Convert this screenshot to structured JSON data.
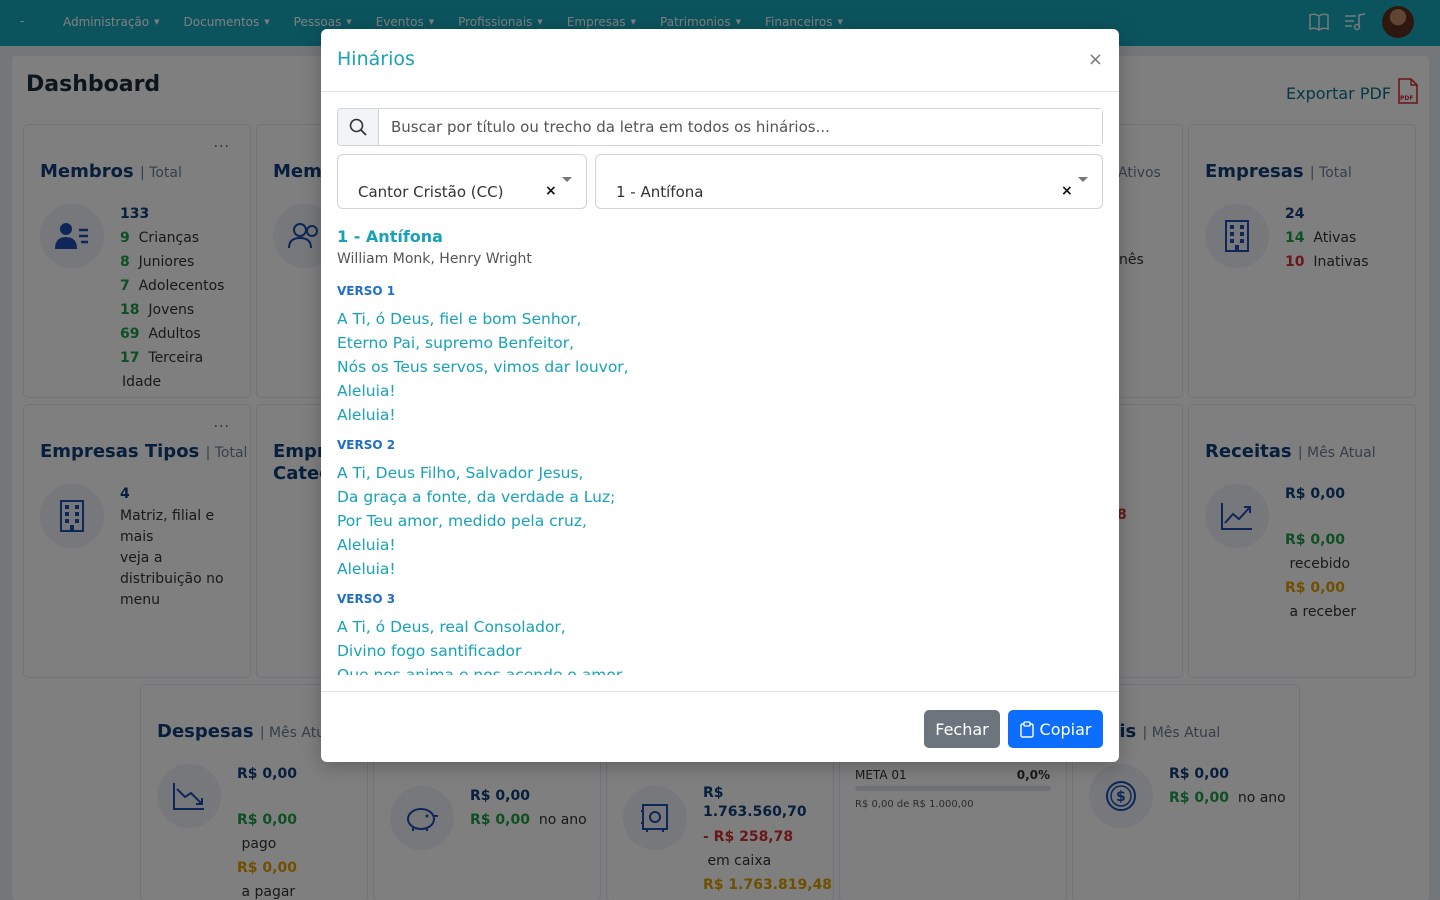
{
  "nav": {
    "brand": "-",
    "items": [
      "Administração",
      "Documentos",
      "Pessoas",
      "Eventos",
      "Profissionais",
      "Empresas",
      "Patrimonios",
      "Financeiros"
    ],
    "caret": "▼"
  },
  "dashboard": {
    "title": "Dashboard",
    "export_label": "Exportar PDF",
    "dots": "...",
    "cards": {
      "membros": {
        "title": "Membros",
        "sub": "| Total",
        "total": "133",
        "rows": [
          [
            "9",
            "Crianças"
          ],
          [
            "8",
            "Juniores"
          ],
          [
            "7",
            "Adolecentos"
          ],
          [
            "18",
            "Jovens"
          ],
          [
            "69",
            "Adultos"
          ],
          [
            "17",
            "Terceira"
          ]
        ],
        "tail": "Idade"
      },
      "membros2": {
        "title": "Memb"
      },
      "empresas": {
        "title": "Empresas",
        "sub": "| Total",
        "total": "24",
        "ativas_n": "14",
        "ativas": "Ativas",
        "inativas_n": "10",
        "inativas": "Inativas"
      },
      "ativos_fragment": "Ativos",
      "mes_fragment": "nês",
      "red_fragment": "8",
      "tipos": {
        "title": "Empresas Tipos",
        "sub": "| Total",
        "total": "4",
        "desc": [
          "Matriz, filial e",
          "mais",
          "veja a",
          "distribuição no",
          "menu"
        ]
      },
      "categ": {
        "line1": "Empr",
        "line2": "Categ"
      },
      "receitas": {
        "title": "Receitas",
        "sub": "| Mês Atual",
        "value": "R$ 0,00",
        "recebido_v": "R$ 0,00",
        "recebido": "recebido",
        "receber_v": "R$ 0,00",
        "receber": "a receber"
      },
      "despesas": {
        "title": "Despesas",
        "sub": "| Mês Atual",
        "value": "R$ 0,00",
        "pago_v": "R$ 0,00",
        "pago": "pago",
        "pagar_v": "R$ 0,00",
        "pagar": "a pagar"
      },
      "piggy": {
        "value": "R$ 0,00",
        "ano_v": "R$ 0,00",
        "ano": "no ano"
      },
      "caixa": {
        "value_l1": "R$",
        "value_l2": "1.763.560,70",
        "neg": "- R$ 258,78",
        "caixa": "em caixa",
        "total": "R$ 1.763.819,48"
      },
      "meta": {
        "name": "META 01",
        "pct": "0,0%",
        "progress": 0.0,
        "desc": "R$ 0,00 de R$ 1.000,00"
      },
      "atuais": {
        "title": "ntuais",
        "sub": "| Mês Atual",
        "value": "R$ 0,00",
        "ano_v": "R$ 0,00",
        "ano": "no ano"
      }
    }
  },
  "modal": {
    "title": "Hinários",
    "close_symbol": "×",
    "search_placeholder": "Buscar por título ou trecho da letra em todos os hinários...",
    "hymnal_select": "Cantor Cristão (CC)",
    "hymn_select": "1 - Antífona",
    "clear_symbol": "×",
    "hymn": {
      "title": "1 - Antífona",
      "author": "William Monk, Henry Wright",
      "verses": [
        {
          "label": "VERSO 1",
          "lines": [
            "A Ti, ó Deus, fiel e bom Senhor,",
            "Eterno Pai, supremo Benfeitor,",
            "Nós os Teus servos, vimos dar louvor,",
            "Aleluia!",
            "Aleluia!"
          ]
        },
        {
          "label": "VERSO 2",
          "lines": [
            "A Ti, Deus Filho, Salvador Jesus,",
            "Da graça a fonte, da verdade a Luz;",
            "Por Teu amor, medido pela cruz,",
            "Aleluia!",
            "Aleluia!"
          ]
        },
        {
          "label": "VERSO 3",
          "lines": [
            "A Ti, ó Deus, real Consolador,",
            "Divino fogo santificador",
            "Que nos anima e nos acende o amor,"
          ]
        }
      ]
    },
    "buttons": {
      "close": "Fechar",
      "copy": "Copiar"
    }
  }
}
